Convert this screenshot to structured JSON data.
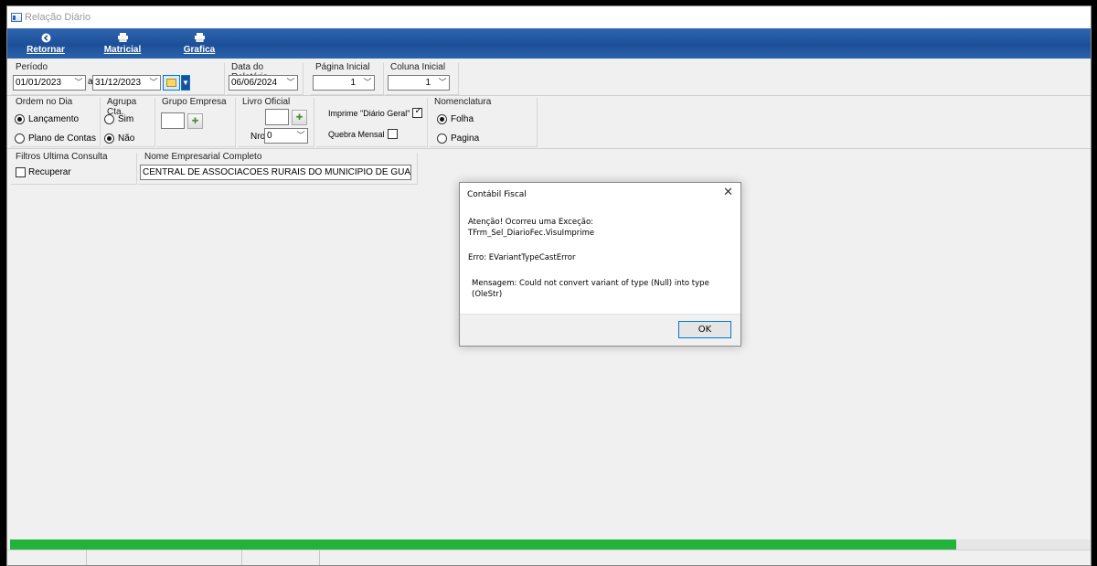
{
  "window": {
    "title": "Relação Diário"
  },
  "toolbar": [
    {
      "icon": "back-arrow-icon",
      "label": "Retornar",
      "glyph": "◀"
    },
    {
      "icon": "printer-icon",
      "label": "Matricial",
      "glyph": "🖶"
    },
    {
      "icon": "printer-icon",
      "label": "Grafica",
      "glyph": "🖶"
    }
  ],
  "periodo": {
    "label": "Período",
    "from": "01/01/2023",
    "sep": "a",
    "to": "31/12/2023"
  },
  "data_relatorio": {
    "label": "Data do Relatório",
    "value": "06/06/2024"
  },
  "pagina_inicial": {
    "label": "Página Inicial",
    "value": "1"
  },
  "coluna_inicial": {
    "label": "Coluna Inicial",
    "value": "1"
  },
  "ordem": {
    "label": "Ordem no Dia",
    "options": [
      "Lançamento",
      "Plano de Contas"
    ],
    "selected": 0
  },
  "agrupa": {
    "label": "Agrupa Cta.",
    "options": [
      "Sim",
      "Não"
    ],
    "selected": 1
  },
  "grupo_empresa": {
    "label": "Grupo Empresa"
  },
  "livro": {
    "label": "Livro Oficial",
    "nro_label": "Nro",
    "nro_value": "0"
  },
  "imprime": {
    "label": "Imprime \"Diário Geral\"",
    "checked": true
  },
  "quebra": {
    "label": "Quebra Mensal",
    "checked": false
  },
  "nomenclatura": {
    "label": "Nomenclatura",
    "options": [
      "Folha",
      "Pagina"
    ],
    "selected": 0
  },
  "filtros": {
    "label": "Filtros Ultima Consulta",
    "recuperar_label": "Recuperar"
  },
  "nome_empresarial": {
    "label": "Nome Empresarial Completo",
    "value": "CENTRAL DE ASSOCIACOES RURAIS DO MUNICIPIO DE GUARAPUA"
  },
  "dialog": {
    "title": "Contábil Fiscal",
    "line1": "Atenção! Ocorreu uma Exceção:",
    "line2": "TFrm_Sel_DiarioFec.VisuImprime",
    "line3": "Erro: EVariantTypeCastError",
    "line4": "Mensagem: Could not convert variant of type (Null) into type (OleStr)",
    "ok": "OK"
  },
  "progress": {
    "value": 0.874,
    "color": "#22b33a"
  },
  "colors": {
    "toolbar": "#1d4f98",
    "progress": "#22b33a"
  }
}
